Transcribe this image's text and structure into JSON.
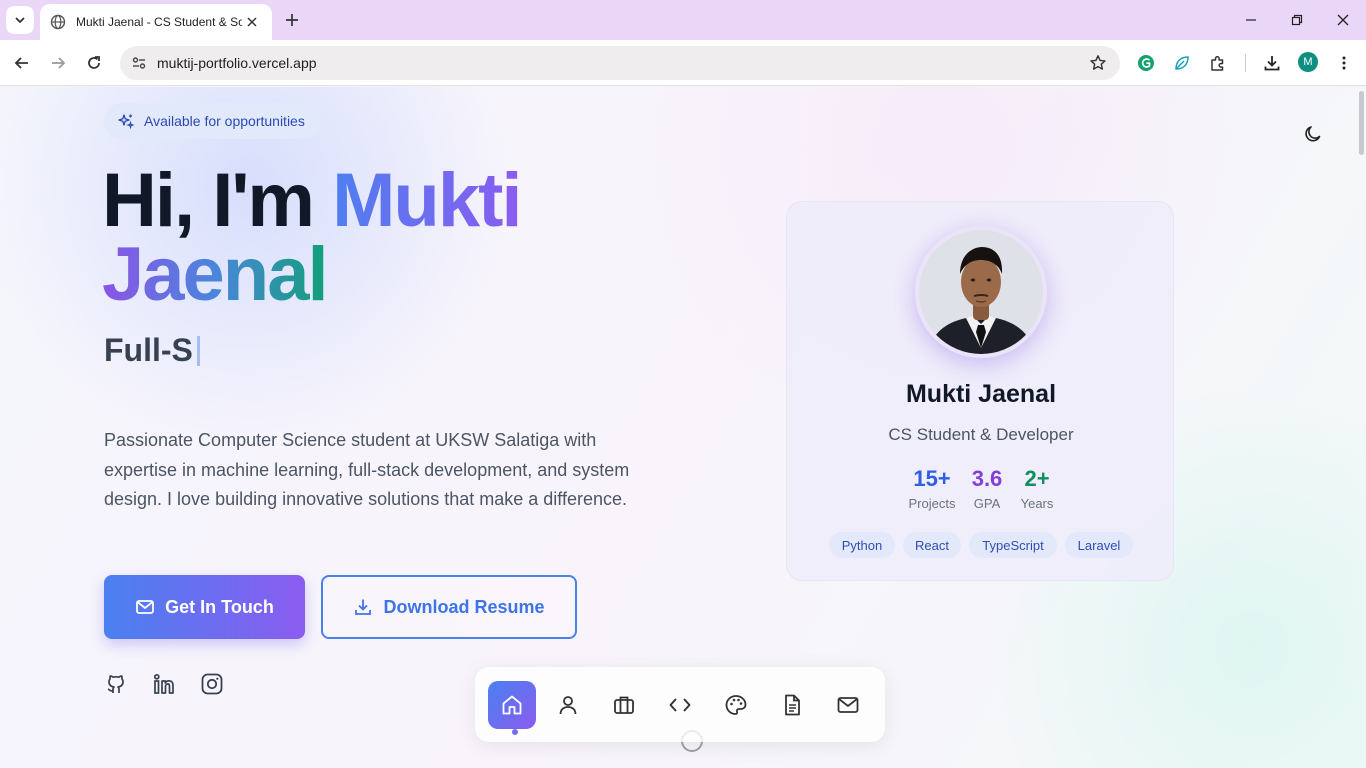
{
  "browser": {
    "tab_title": "Mukti Jaenal - CS Student & Software Developer",
    "url": "muktij-portfolio.vercel.app",
    "profile_initial": "M"
  },
  "hero": {
    "badge": "Available for opportunities",
    "greeting": "Hi, I'm",
    "first_name": "Mukti",
    "last_name": "Jaenal",
    "typed_text": "Full-S",
    "bio": "Passionate Computer Science student at UKSW Salatiga with expertise in machine learning, full-stack development, and system design. I love building innovative solutions that make a difference.",
    "primary_cta": "Get In Touch",
    "secondary_cta": "Download Resume"
  },
  "card": {
    "name": "Mukti Jaenal",
    "role": "CS Student & Developer",
    "stats": [
      {
        "value": "15+",
        "label": "Projects",
        "color": "#2f5fe0"
      },
      {
        "value": "3.6",
        "label": "GPA",
        "color": "#8340d8"
      },
      {
        "value": "2+",
        "label": "Years",
        "color": "#0e8f5f"
      }
    ],
    "skills": [
      "Python",
      "React",
      "TypeScript",
      "Laravel"
    ]
  },
  "social": [
    "github-icon",
    "linkedin-icon",
    "instagram-icon"
  ],
  "dock": [
    "home",
    "about",
    "experience",
    "projects",
    "design",
    "resume",
    "contact"
  ],
  "colors": {
    "accent_blue": "#4a80f0",
    "accent_purple": "#8b5cf0",
    "accent_green": "#12a078"
  }
}
